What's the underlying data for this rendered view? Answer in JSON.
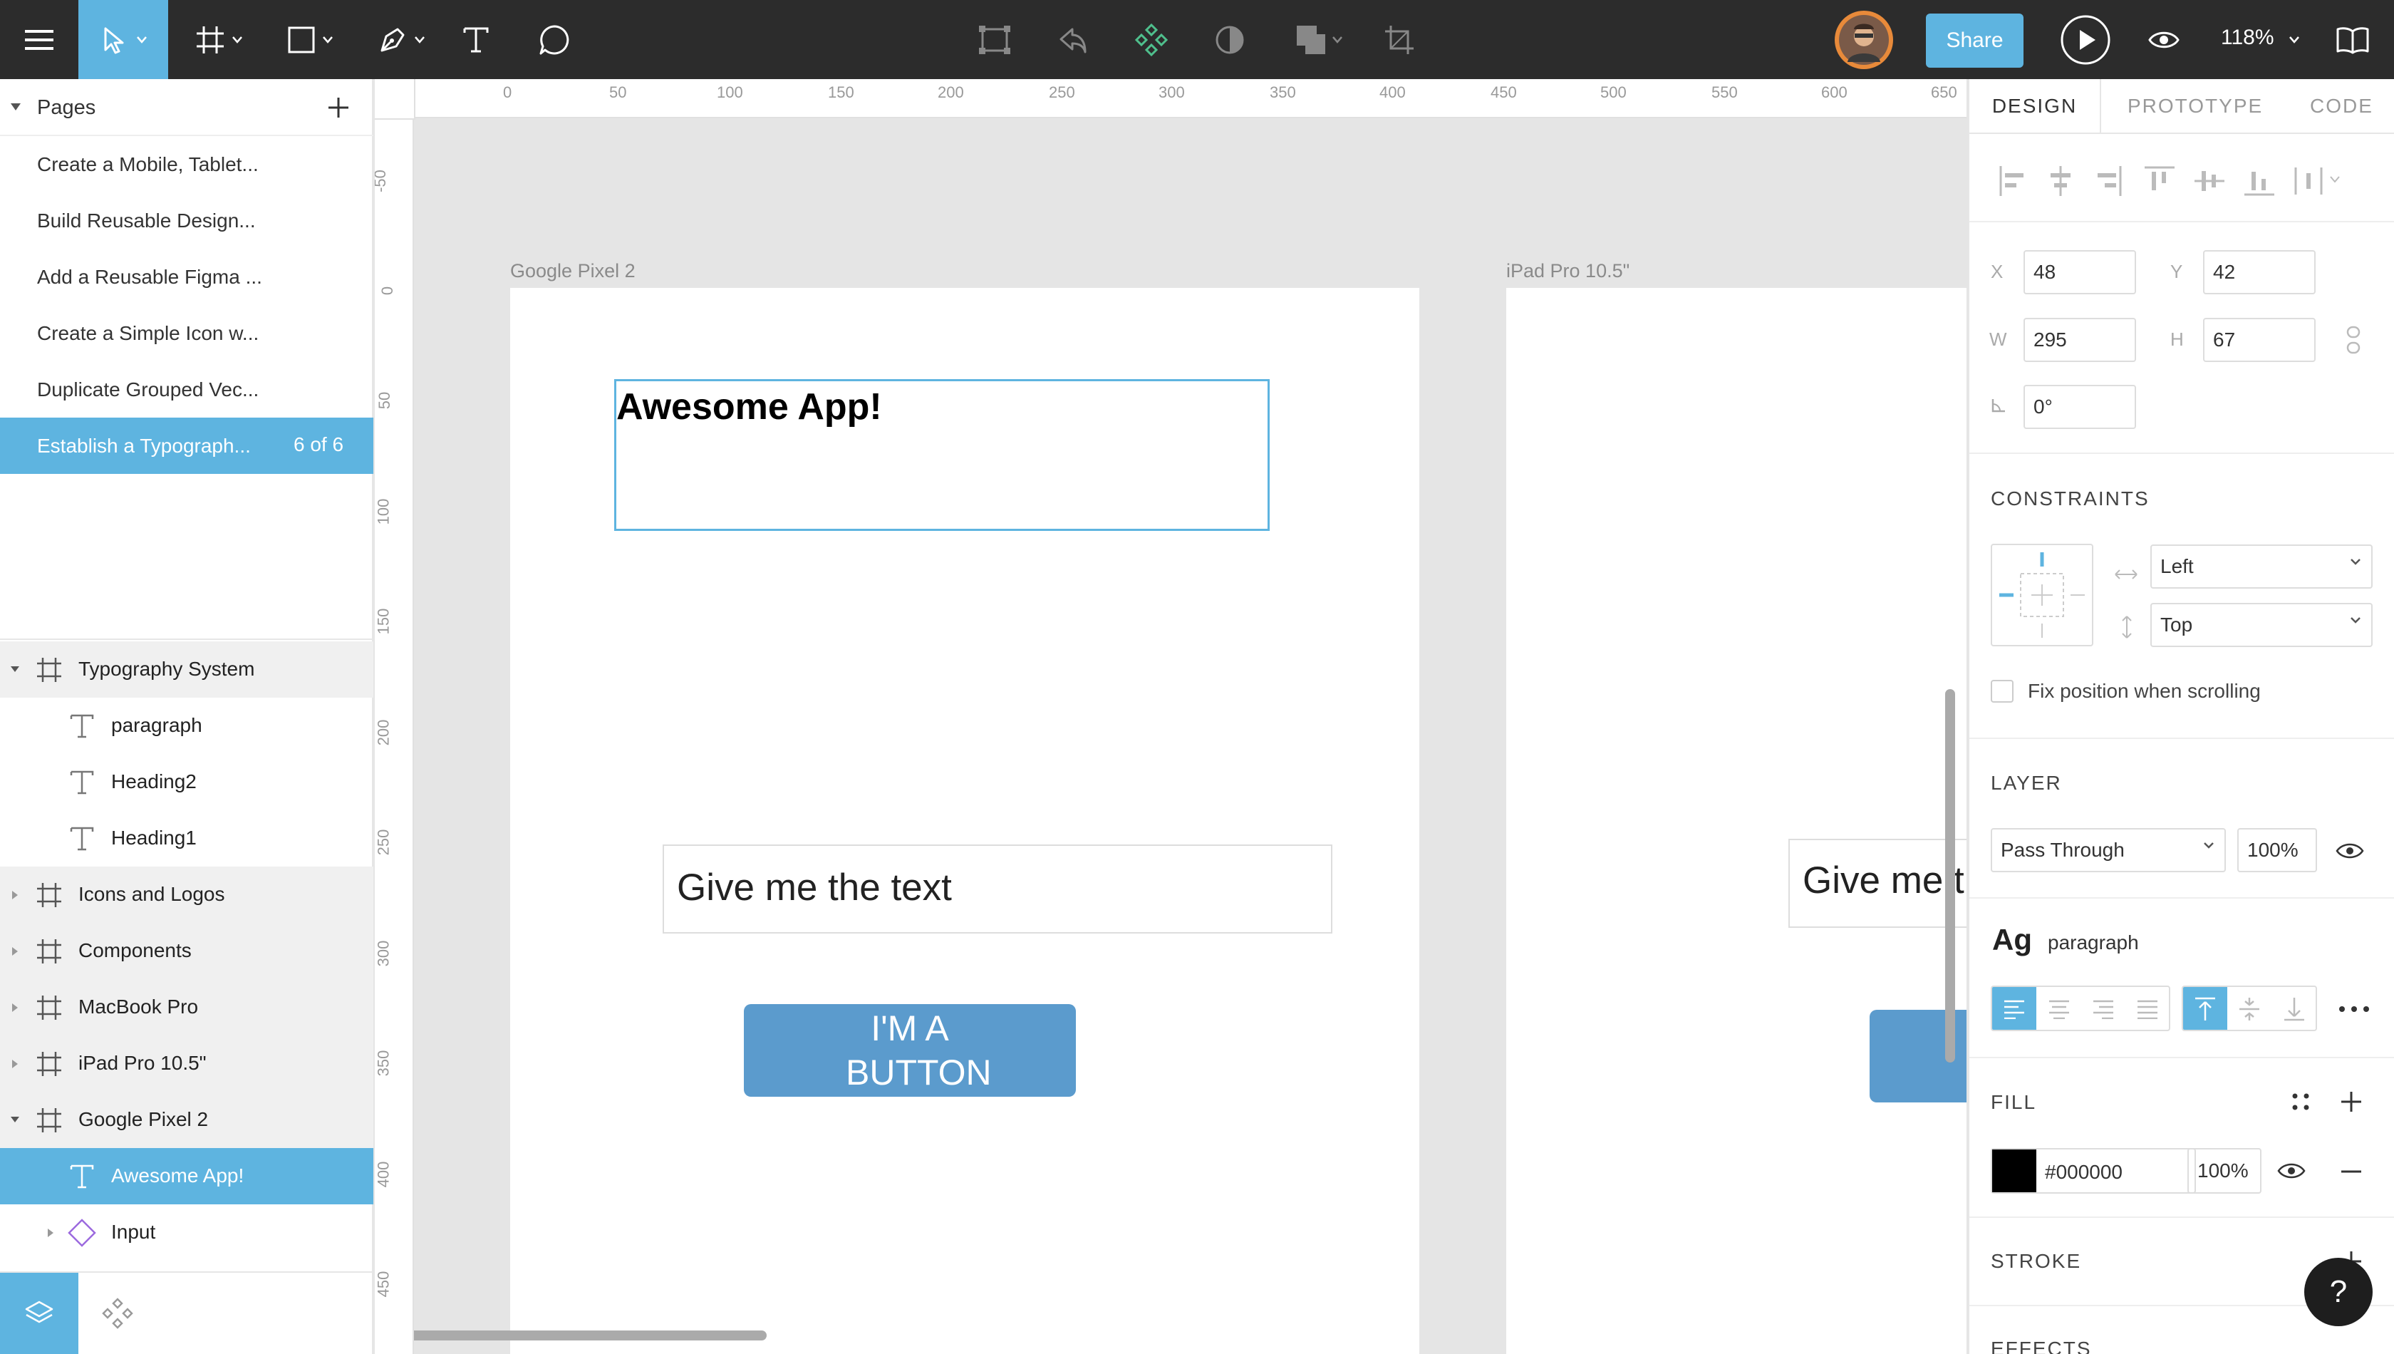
{
  "toolbar": {
    "share_label": "Share",
    "zoom": "118%"
  },
  "pages": {
    "title": "Pages",
    "items": [
      {
        "label": "Create a Mobile, Tablet..."
      },
      {
        "label": "Build Reusable Design..."
      },
      {
        "label": "Add a Reusable Figma ..."
      },
      {
        "label": "Create a Simple Icon w..."
      },
      {
        "label": "Duplicate Grouped Vec..."
      },
      {
        "label": "Establish a Typograph...",
        "count": "6 of 6"
      }
    ]
  },
  "layers": [
    {
      "label": "Typography System",
      "type": "frame"
    },
    {
      "label": "paragraph",
      "type": "text"
    },
    {
      "label": "Heading2",
      "type": "text"
    },
    {
      "label": "Heading1",
      "type": "text"
    },
    {
      "label": "Icons and Logos",
      "type": "frame"
    },
    {
      "label": "Components",
      "type": "frame"
    },
    {
      "label": "MacBook Pro",
      "type": "frame"
    },
    {
      "label": "iPad Pro 10.5\"",
      "type": "frame"
    },
    {
      "label": "Google Pixel 2",
      "type": "frame"
    },
    {
      "label": "Awesome App!",
      "type": "text"
    },
    {
      "label": "Input",
      "type": "component"
    }
  ],
  "canvas": {
    "ruler_top": [
      "0",
      "50",
      "100",
      "150",
      "200",
      "250",
      "300",
      "350",
      "400",
      "450",
      "500",
      "550",
      "600",
      "650"
    ],
    "ruler_left": [
      "-50",
      "0",
      "50",
      "100",
      "150",
      "200",
      "250",
      "300",
      "350",
      "400",
      "450"
    ],
    "frame1_label": "Google Pixel 2",
    "frame2_label": "iPad Pro 10.5\"",
    "heading_text": "Awesome App!",
    "input_text": "Give me the text",
    "input_text_clipped": "Give me t",
    "button_text": "I'M A BUTTON"
  },
  "design_panel": {
    "tabs": [
      "DESIGN",
      "PROTOTYPE",
      "CODE"
    ],
    "x_label": "X",
    "x": "48",
    "y_label": "Y",
    "y": "42",
    "w_label": "W",
    "w": "295",
    "h_label": "H",
    "h": "67",
    "rotation": "0°",
    "constraints_title": "CONSTRAINTS",
    "constraint_h": "Left",
    "constraint_v": "Top",
    "fix_position_label": "Fix position when scrolling",
    "layer_title": "LAYER",
    "blend_mode": "Pass Through",
    "opacity": "100%",
    "text_style_sample": "Ag",
    "text_style_name": "paragraph",
    "fill_title": "FILL",
    "fill_hex": "#000000",
    "fill_opacity": "100%",
    "stroke_title": "STROKE",
    "effects_title": "EFFECTS",
    "help": "?"
  },
  "colors": {
    "toolbar_bg": "#2c2c2c",
    "accent": "#5eb4e0",
    "button_fill": "#5b9bcd",
    "fill_swatch": "#000000"
  }
}
